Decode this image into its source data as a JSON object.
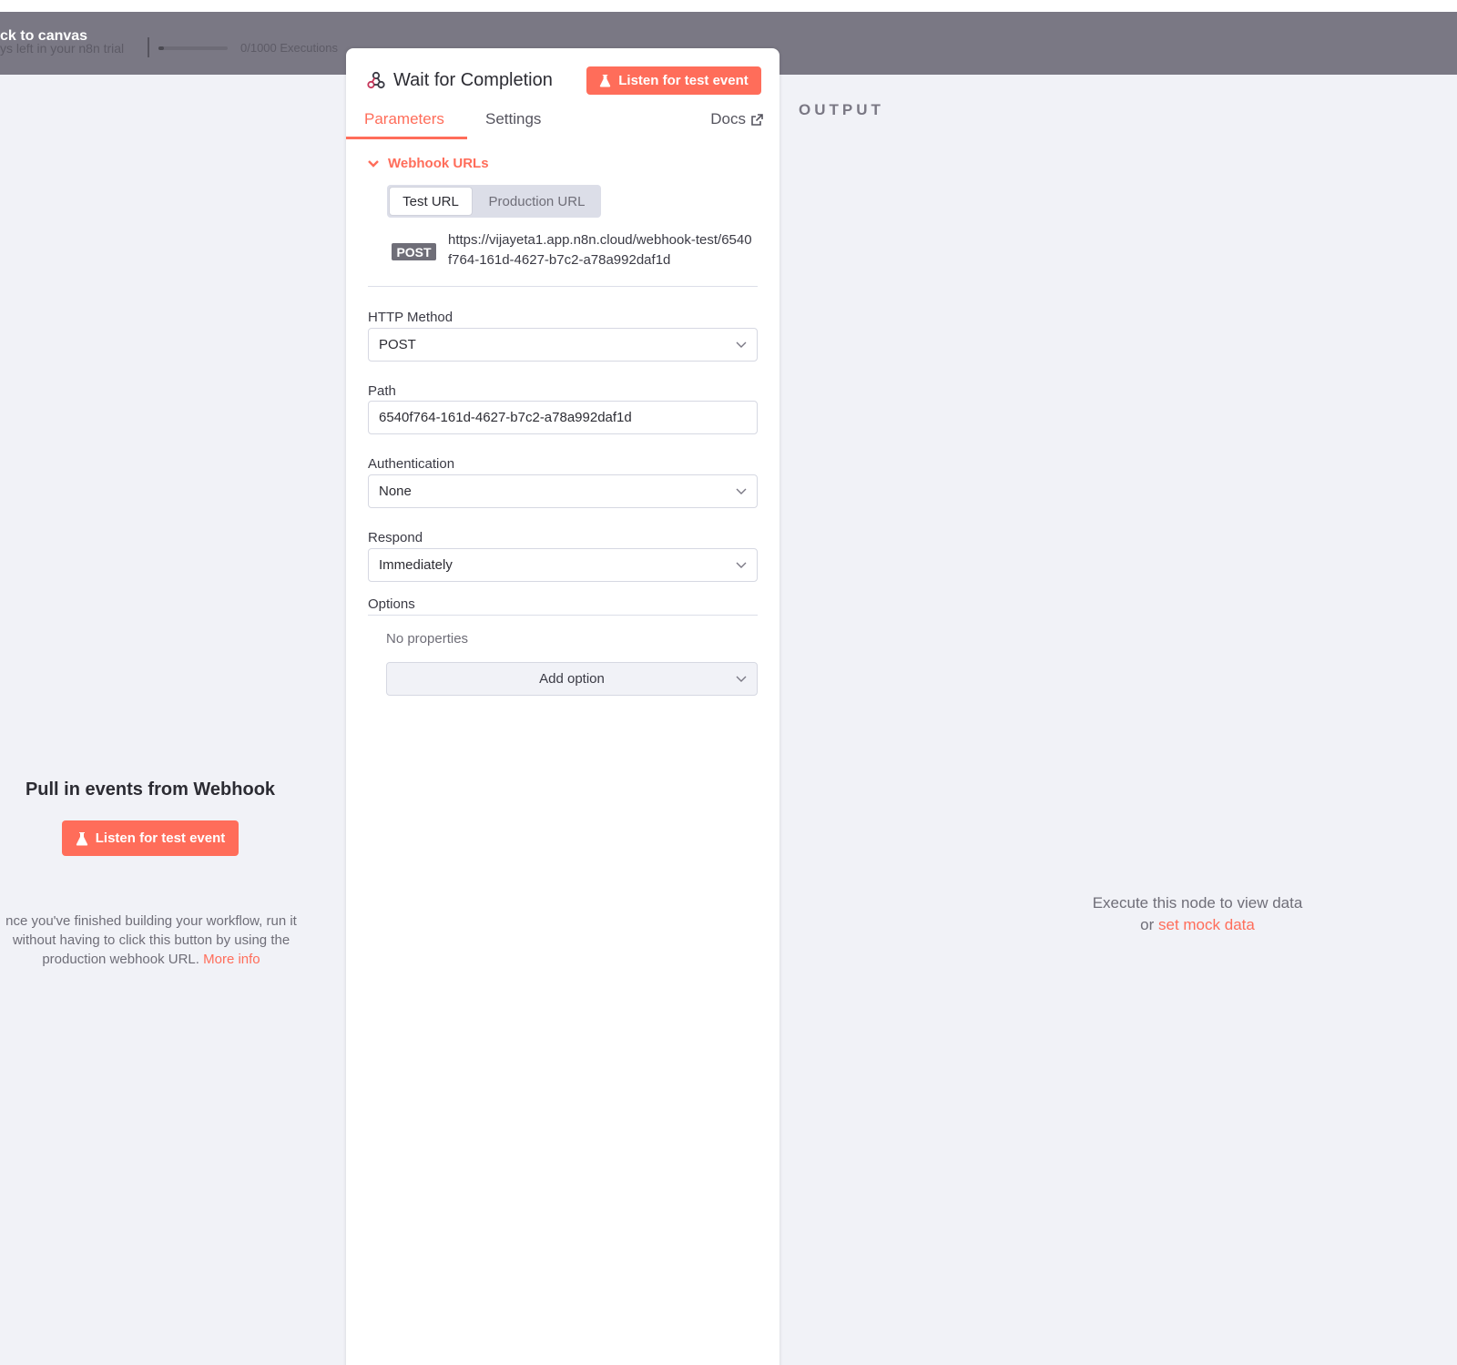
{
  "topbar": {
    "back_label": "ck to canvas",
    "trial_text": "ys left in your n8n trial",
    "executions_text": "0/1000 Executions",
    "executions_progress": 0.0
  },
  "input_panel": {
    "title": "Pull in events from Webhook",
    "listen_button": "Listen for test event",
    "hint": "nce you've finished building your workflow, run it without having to click this button by using the production webhook URL.",
    "more_info": "More info"
  },
  "node": {
    "title": "Wait for Completion",
    "listen_button": "Listen for test event",
    "tabs": [
      {
        "label": "Parameters",
        "active": true
      },
      {
        "label": "Settings",
        "active": false
      }
    ],
    "docs_label": "Docs",
    "webhook_section": {
      "title": "Webhook URLs",
      "url_tabs": [
        "Test URL",
        "Production URL"
      ],
      "method": "POST",
      "url": "https://vijayeta1.app.n8n.cloud/webhook-test/6540f764-161d-4627-b7c2-a78a992daf1d"
    },
    "fields": {
      "http_method_label": "HTTP Method",
      "http_method_value": "POST",
      "path_label": "Path",
      "path_value": "6540f764-161d-4627-b7c2-a78a992daf1d",
      "auth_label": "Authentication",
      "auth_value": "None",
      "respond_label": "Respond",
      "respond_value": "Immediately"
    },
    "options": {
      "label": "Options",
      "empty_text": "No properties",
      "add_button": "Add option"
    }
  },
  "output_panel": {
    "label": "OUTPUT",
    "hint_line1": "Execute this node to view data",
    "hint_prefix": "or ",
    "hint_link": "set mock data"
  },
  "colors": {
    "accent": "#ff6d5a",
    "dim_bar": "#7a7884",
    "panel_bg": "#f1f2f7"
  }
}
